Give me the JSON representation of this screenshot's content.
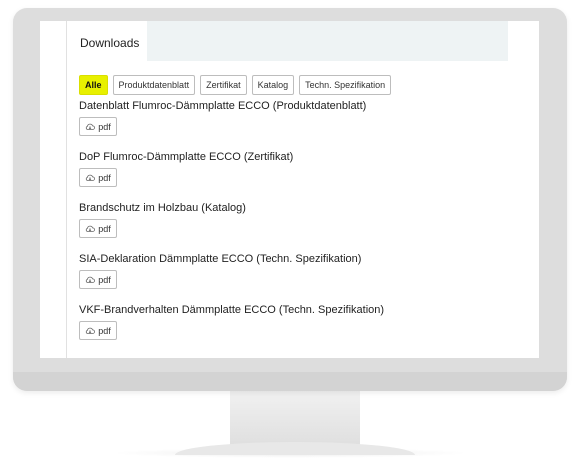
{
  "downloads": {
    "tab_label": "Downloads",
    "filters": [
      {
        "label": "Alle",
        "active": true
      },
      {
        "label": "Produktdatenblatt",
        "active": false
      },
      {
        "label": "Zertifikat",
        "active": false
      },
      {
        "label": "Katalog",
        "active": false
      },
      {
        "label": "Techn. Spezifikation",
        "active": false
      }
    ],
    "items": [
      {
        "title": "Datenblatt Flumroc-Dämmplatte ECCO  (Produktdatenblatt)",
        "button": "pdf"
      },
      {
        "title": "DoP Flumroc-Dämmplatte ECCO  (Zertifikat)",
        "button": "pdf"
      },
      {
        "title": "Brandschutz im Holzbau  (Katalog)",
        "button": "pdf"
      },
      {
        "title": "SIA-Deklaration Dämmplatte ECCO  (Techn. Spezifikation)",
        "button": "pdf"
      },
      {
        "title": "VKF-Brandverhalten Dämmplatte ECCO  (Techn. Spezifikation)",
        "button": "pdf"
      }
    ],
    "icons": {
      "download": "cloud-download-icon"
    },
    "colors": {
      "active_filter_bg": "#e8f000",
      "tab_bar_bg": "#eef3f4",
      "monitor_frame": "#dddddd"
    }
  }
}
